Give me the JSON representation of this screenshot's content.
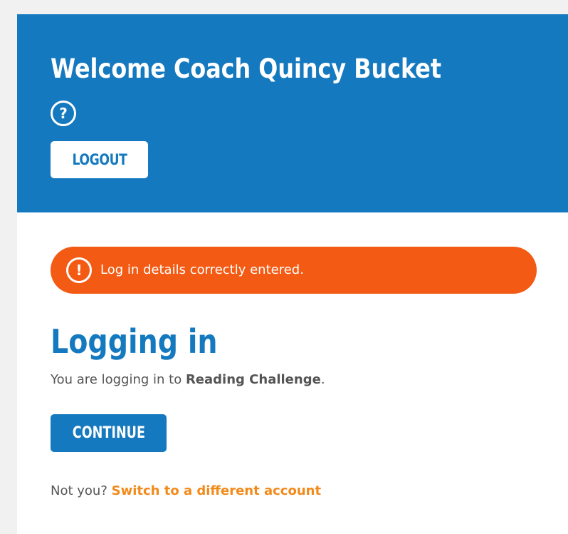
{
  "header": {
    "welcome_title": "Welcome Coach Quincy Bucket",
    "help_icon_glyph": "?",
    "logout_label": "LOGOUT",
    "background_color": "#1479bf"
  },
  "alert": {
    "icon_glyph": "!",
    "icon_name": "exclamation-circle-icon",
    "message": "Log in details correctly entered.",
    "background_color": "#f35a13"
  },
  "main": {
    "title": "Logging in",
    "intro_prefix": "You are logging in to ",
    "app_name": "Reading Challenge",
    "intro_suffix": ".",
    "continue_label": "CONTINUE",
    "not_you_text": "Not you? ",
    "switch_account_link": "Switch to a different account",
    "link_color": "#f28a1a"
  }
}
